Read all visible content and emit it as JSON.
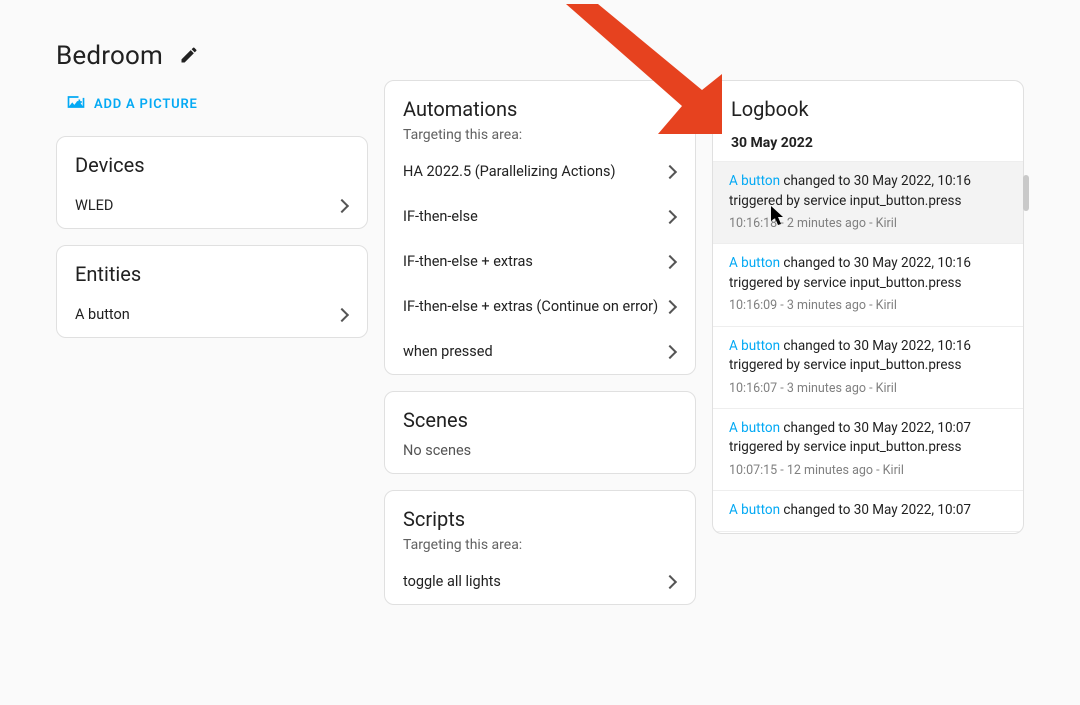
{
  "colors": {
    "accent": "#03a9f4",
    "annotation": "#e6421f"
  },
  "header": {
    "title": "Bedroom",
    "add_picture_label": "ADD A PICTURE"
  },
  "devices": {
    "title": "Devices",
    "items": [
      {
        "label": "WLED"
      }
    ]
  },
  "entities": {
    "title": "Entities",
    "items": [
      {
        "label": "A button"
      }
    ]
  },
  "automations": {
    "title": "Automations",
    "subtitle": "Targeting this area:",
    "items": [
      {
        "label": "HA 2022.5 (Parallelizing Actions)"
      },
      {
        "label": "IF-then-else"
      },
      {
        "label": "IF-then-else + extras"
      },
      {
        "label": "IF-then-else + extras (Continue on error)"
      },
      {
        "label": "when pressed"
      }
    ]
  },
  "scenes": {
    "title": "Scenes",
    "empty_text": "No scenes"
  },
  "scripts": {
    "title": "Scripts",
    "subtitle": "Targeting this area:",
    "items": [
      {
        "label": "toggle all lights"
      }
    ]
  },
  "logbook": {
    "title": "Logbook",
    "date_header": "30 May 2022",
    "entries": [
      {
        "entity": "A button",
        "text_prefix": "changed to 30 May 2022, 10:16 triggered by service input_button.press",
        "meta": "10:16:18 - 2 minutes ago - Kiril",
        "hovered": true
      },
      {
        "entity": "A button",
        "text_prefix": "changed to 30 May 2022, 10:16 triggered by service input_button.press",
        "meta": "10:16:09 - 3 minutes ago - Kiril",
        "hovered": false
      },
      {
        "entity": "A button",
        "text_prefix": "changed to 30 May 2022, 10:16 triggered by service input_button.press",
        "meta": "10:16:07 - 3 minutes ago - Kiril",
        "hovered": false
      },
      {
        "entity": "A button",
        "text_prefix": "changed to 30 May 2022, 10:07 triggered by service input_button.press",
        "meta": "10:07:15 - 12 minutes ago - Kiril",
        "hovered": false
      },
      {
        "entity": "A button",
        "text_prefix": "changed to 30 May 2022, 10:07",
        "meta": "",
        "hovered": false
      }
    ]
  }
}
